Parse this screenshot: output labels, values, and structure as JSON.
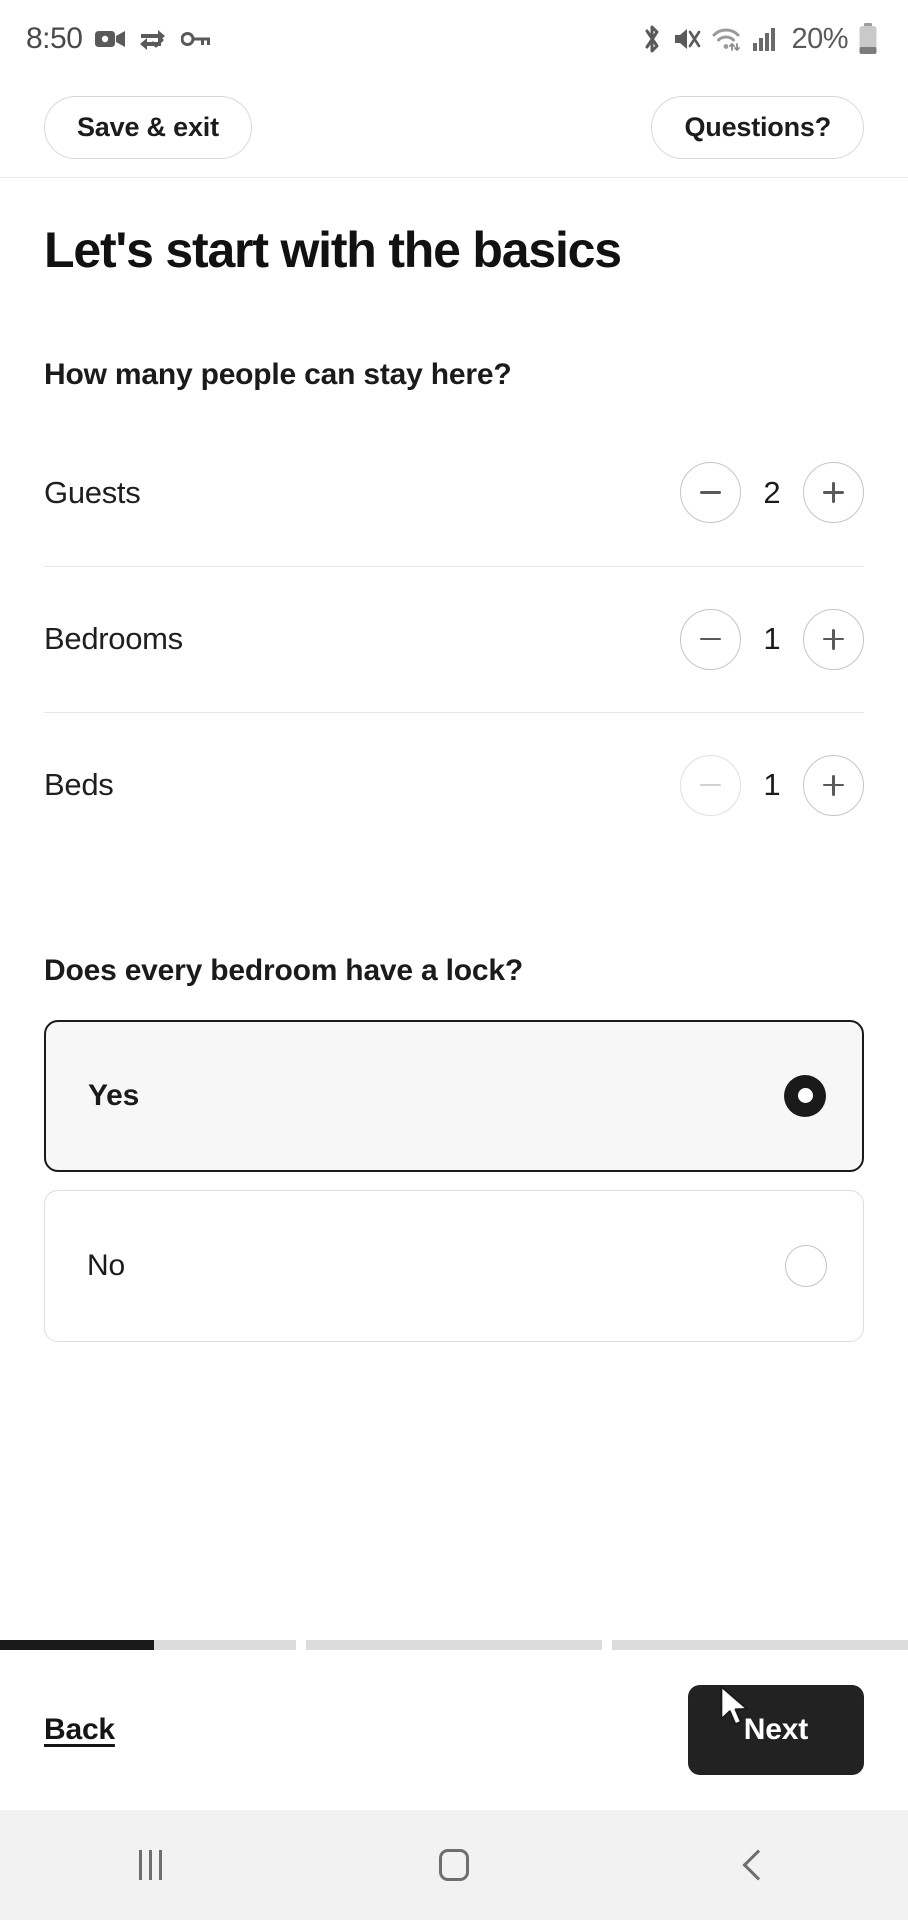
{
  "status_bar": {
    "time": "8:50",
    "left_icons": [
      "video-camera-icon",
      "data-sync-icon",
      "key-icon"
    ],
    "right_icons": [
      "bluetooth-icon",
      "volume-muted-icon",
      "wifi-icon",
      "cellular-signal-icon"
    ],
    "battery_percent": "20%"
  },
  "top_bar": {
    "save_exit_label": "Save & exit",
    "questions_label": "Questions?"
  },
  "main": {
    "page_title": "Let's start with the basics",
    "capacity_question": "How many people can stay here?",
    "counters": [
      {
        "label": "Guests",
        "value": "2",
        "minus_disabled": false,
        "plus_disabled": false
      },
      {
        "label": "Bedrooms",
        "value": "1",
        "minus_disabled": false,
        "plus_disabled": false
      },
      {
        "label": "Beds",
        "value": "1",
        "minus_disabled": true,
        "plus_disabled": false
      }
    ],
    "lock_question": "Does every bedroom have a lock?",
    "lock_options": [
      {
        "label": "Yes",
        "selected": true
      },
      {
        "label": "No",
        "selected": false
      }
    ]
  },
  "footer": {
    "progress": {
      "segments": 3,
      "active_segment": 1,
      "active_fill_percent": 52
    },
    "back_label": "Back",
    "next_label": "Next"
  },
  "nav_bar": {
    "recents_icon": "recents-icon",
    "home_icon": "home-icon",
    "back_icon": "back-chevron-icon"
  },
  "colors": {
    "accent_dark": "#222222",
    "selected_border": "#1a1a1a",
    "selected_bg": "#f7f7f7",
    "divider": "#e8e8e8",
    "progress_track": "#dcdcdc",
    "nav_bg": "#f2f2f2"
  }
}
